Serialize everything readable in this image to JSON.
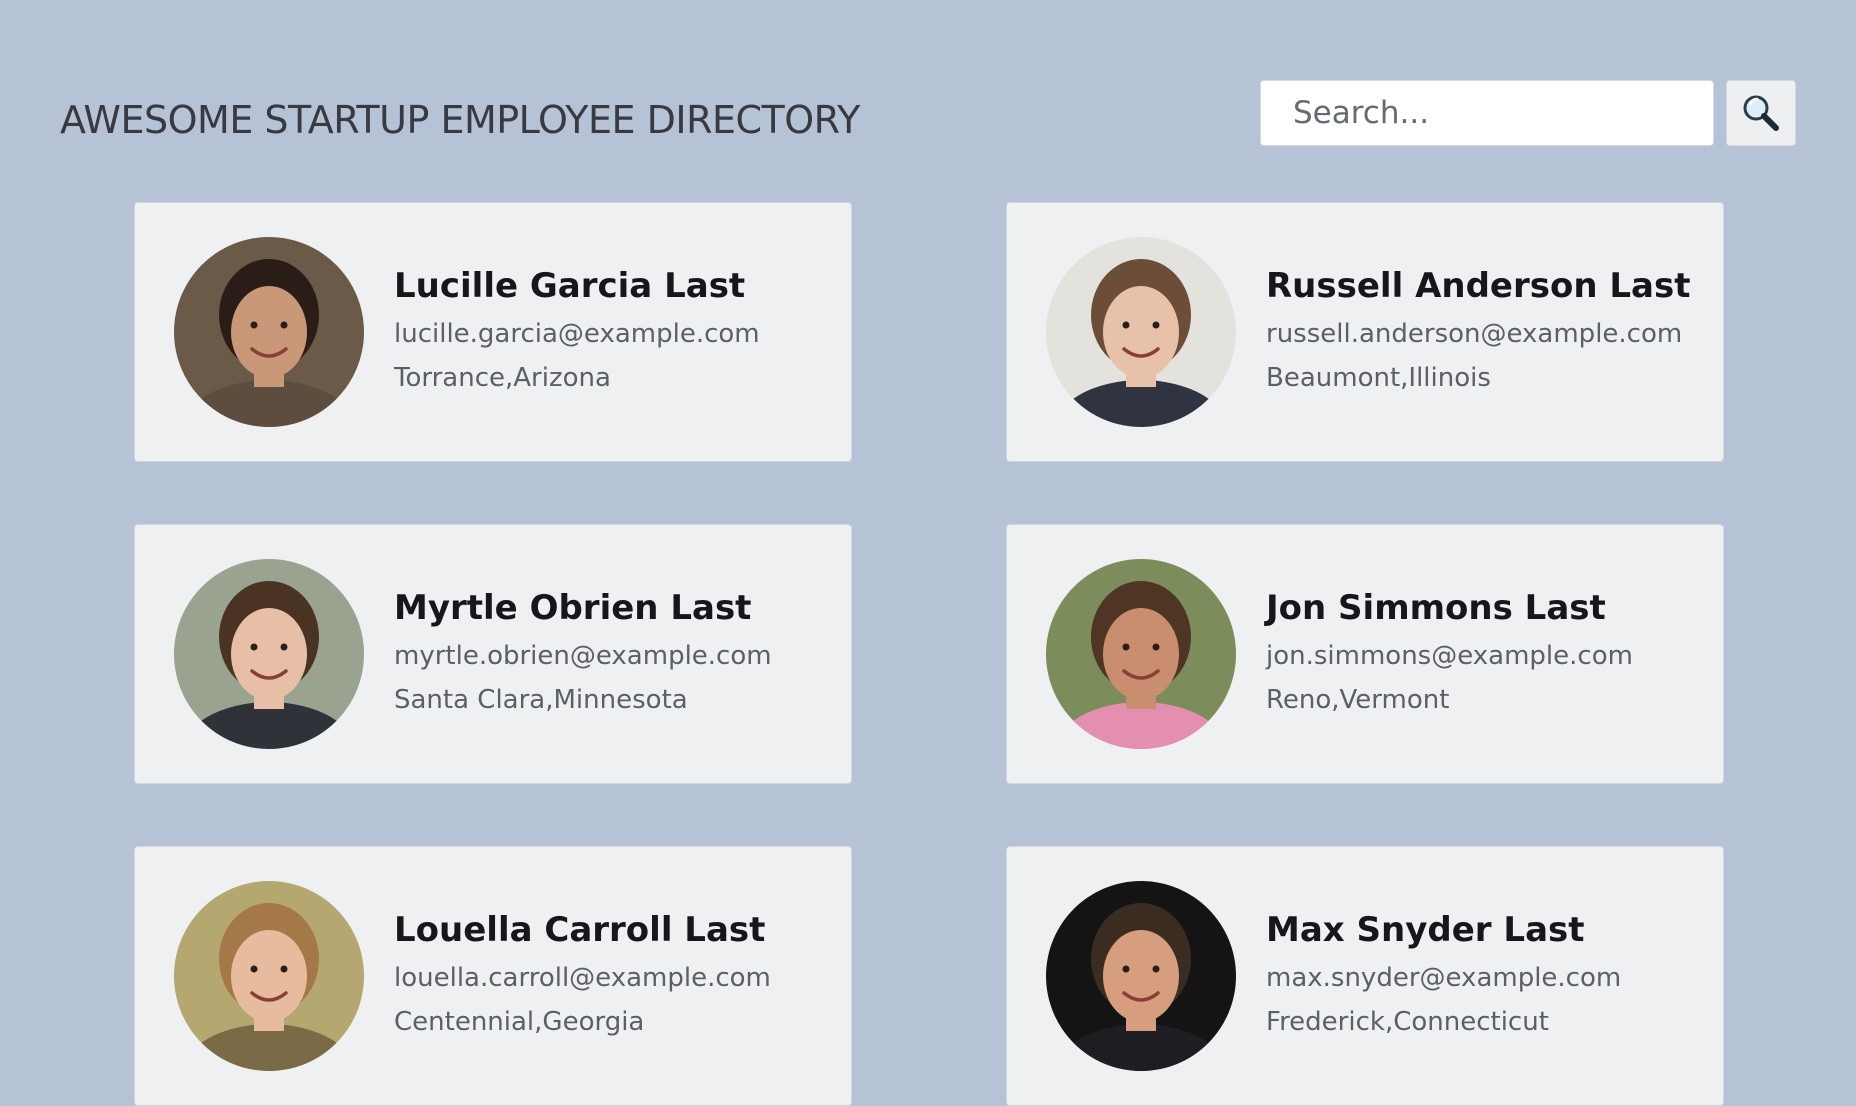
{
  "header": {
    "title": "AWESOME STARTUP EMPLOYEE DIRECTORY"
  },
  "search": {
    "placeholder": "Search...",
    "button_icon": "magnifying-glass-icon"
  },
  "employees": [
    {
      "name": "Lucille Garcia Last",
      "email": "lucille.garcia@example.com",
      "location": "Torrance,Arizona",
      "avatar": {
        "bg": "#6b5a48",
        "skin": "#c99878",
        "hair": "#2a1d17",
        "shirt": "#5c4d3f"
      }
    },
    {
      "name": "Russell Anderson Last",
      "email": "russell.anderson@example.com",
      "location": "Beaumont,Illinois",
      "avatar": {
        "bg": "#e4e2dd",
        "skin": "#e8c2a8",
        "hair": "#6c4e38",
        "shirt": "#2f3440"
      }
    },
    {
      "name": "Myrtle Obrien Last",
      "email": "myrtle.obrien@example.com",
      "location": "Santa Clara,Minnesota",
      "avatar": {
        "bg": "#9aa38f",
        "skin": "#e6bfa6",
        "hair": "#4a3323",
        "shirt": "#30323a"
      }
    },
    {
      "name": "Jon Simmons Last",
      "email": "jon.simmons@example.com",
      "location": "Reno,Vermont",
      "avatar": {
        "bg": "#7c8c5a",
        "skin": "#c98e6f",
        "hair": "#4e3524",
        "shirt": "#e58fb0"
      }
    },
    {
      "name": "Louella Carroll Last",
      "email": "louella.carroll@example.com",
      "location": "Centennial,Georgia",
      "avatar": {
        "bg": "#b4a870",
        "skin": "#e7bc9e",
        "hair": "#a57848",
        "shirt": "#7a6a45"
      }
    },
    {
      "name": "Max Snyder Last",
      "email": "max.snyder@example.com",
      "location": "Frederick,Connecticut",
      "avatar": {
        "bg": "#141414",
        "skin": "#d69d7e",
        "hair": "#3b2c22",
        "shirt": "#1e1e22"
      }
    }
  ]
}
